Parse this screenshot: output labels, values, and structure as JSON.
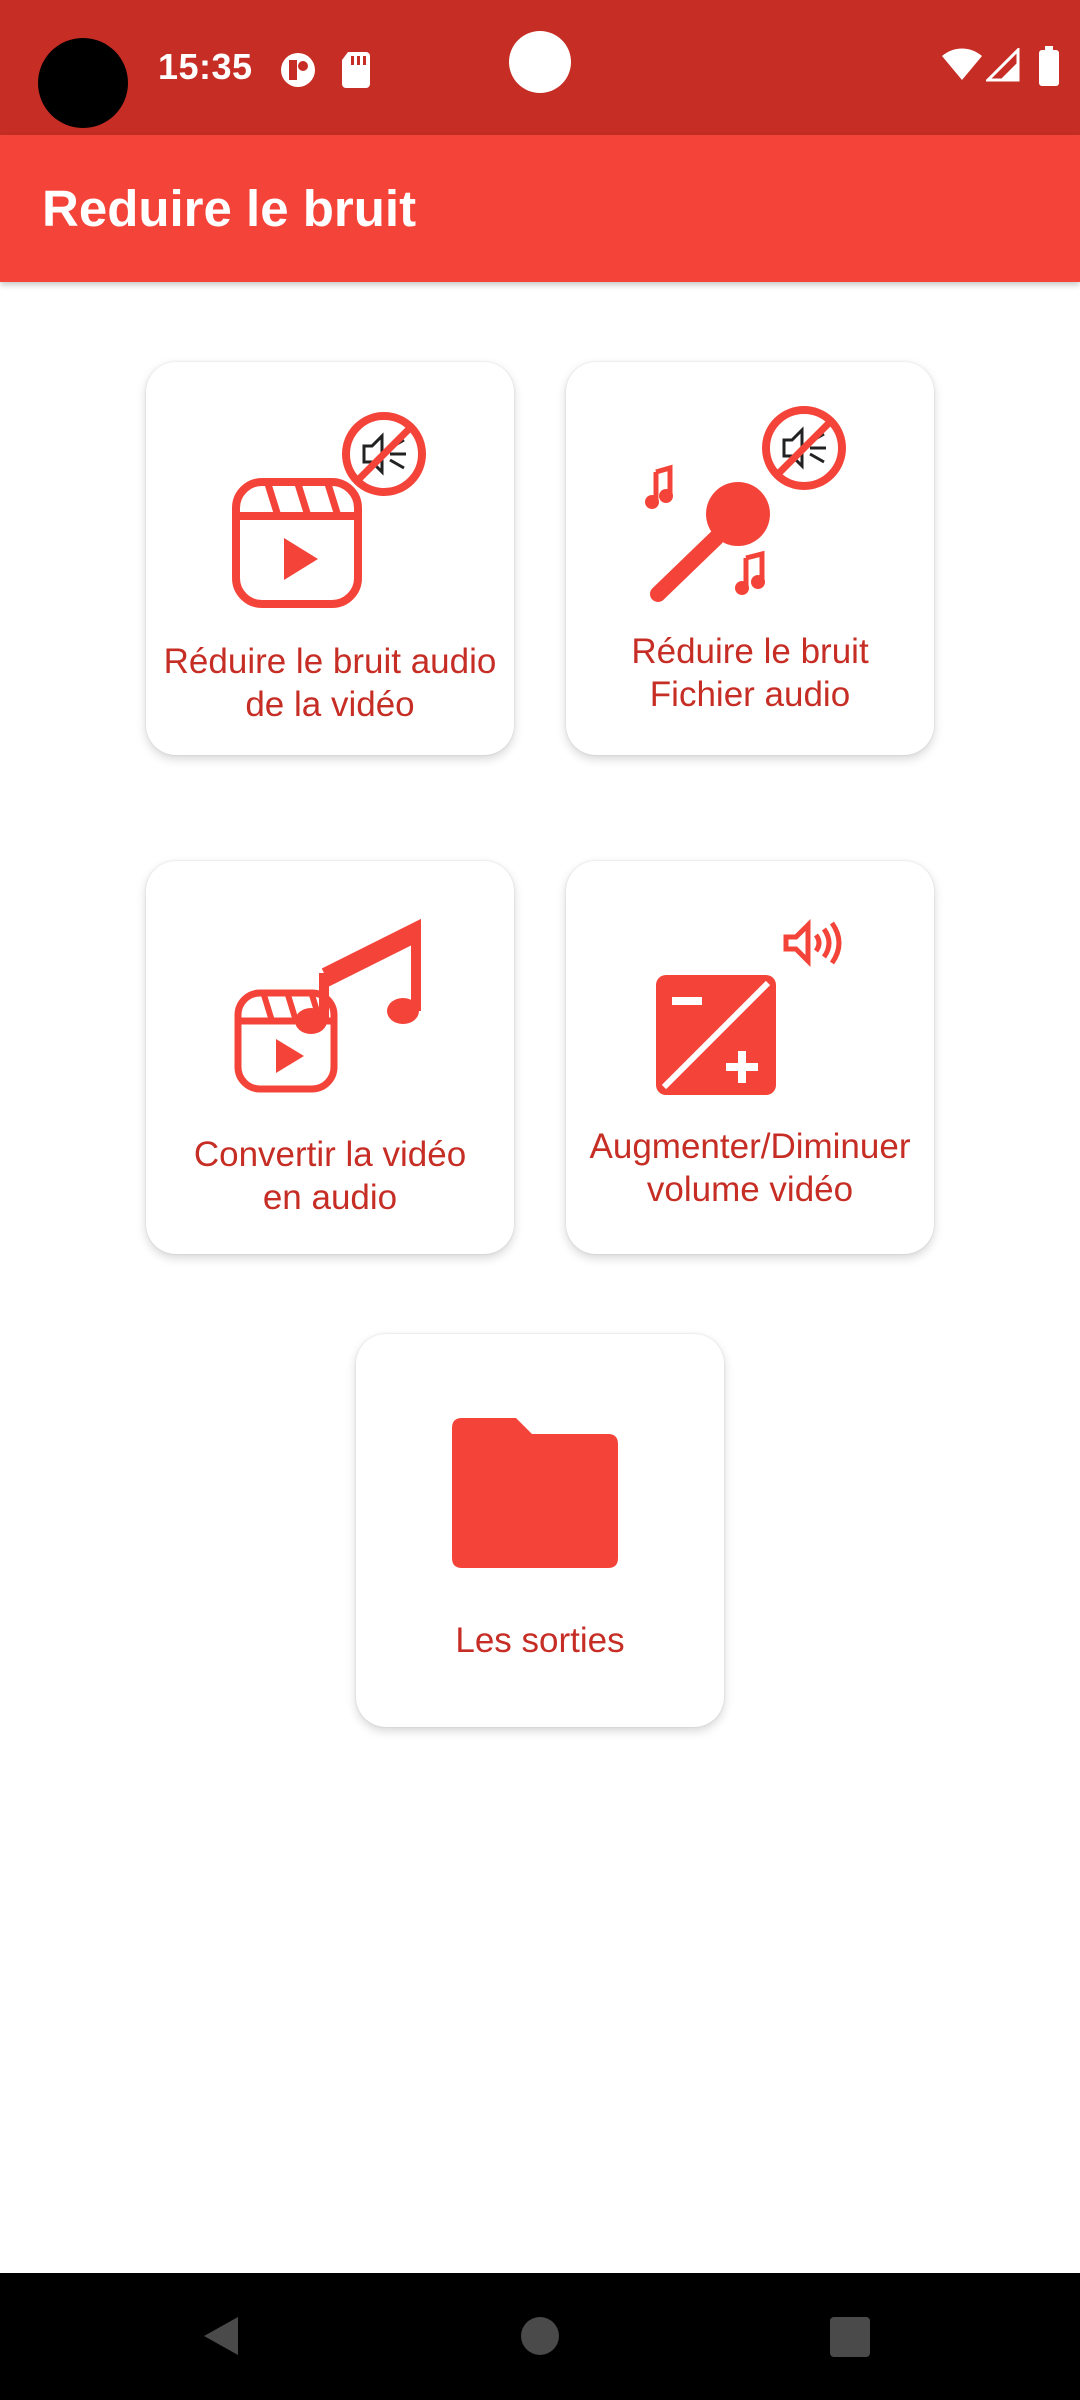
{
  "status_bar": {
    "time": "15:35",
    "icons": [
      "camera-cutout",
      "data-saver-icon",
      "sd-card-icon",
      "wifi-icon",
      "signal-icon",
      "battery-icon"
    ]
  },
  "app_bar": {
    "title": "Reduire le bruit"
  },
  "cards": [
    {
      "id": "reduce-video-noise",
      "icon": "video-mute-icon",
      "label_line1": "Réduire le bruit audio",
      "label_line2": "de la vidéo"
    },
    {
      "id": "reduce-audio-noise",
      "icon": "microphone-mute-icon",
      "label_line1": "Réduire le bruit",
      "label_line2": "Fichier audio"
    },
    {
      "id": "convert-video-audio",
      "icon": "video-to-music-icon",
      "label_line1": "Convertir la vidéo",
      "label_line2": "en audio"
    },
    {
      "id": "video-volume",
      "icon": "volume-exposure-icon",
      "label_line1": "Augmenter/Diminuer",
      "label_line2": "volume vidéo"
    },
    {
      "id": "outputs",
      "icon": "folder-icon",
      "label_line1": "Les sorties"
    }
  ],
  "colors": {
    "status_bar": "#c62d24",
    "app_bar": "#f4443a",
    "accent": "#f4443a",
    "label_text": "#c62d24",
    "nav_bar": "#000000"
  },
  "nav_bar": {
    "buttons": [
      "back-icon",
      "home-icon",
      "recents-icon"
    ]
  }
}
